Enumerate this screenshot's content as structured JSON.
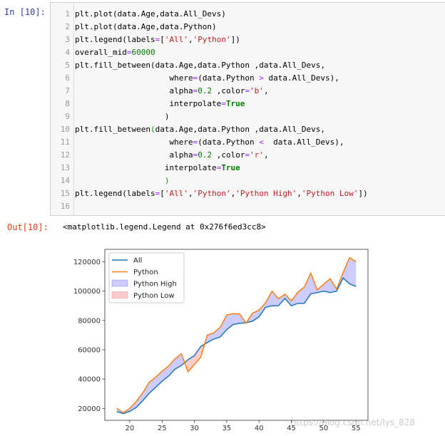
{
  "cell": {
    "in_prompt": "In [10]:",
    "out_prompt": "Out[10]:",
    "output_text": "<matplotlib.legend.Legend at 0x276f6ed3cc8>",
    "line_numbers": [
      "1",
      "2",
      "3",
      "4",
      "5",
      "6",
      "7",
      "8",
      "9",
      "10",
      "11",
      "12",
      "13",
      "14",
      "15",
      "16"
    ],
    "code_lines": [
      [
        [
          "plt.plot(data.Age,data.All_Devs)",
          ""
        ]
      ],
      [
        [
          "plt.plot(data.Age,data.Python)",
          ""
        ]
      ],
      [
        [
          "plt.legend(labels",
          ""
        ],
        [
          "=",
          "op"
        ],
        [
          "[",
          ""
        ],
        [
          "'All'",
          "str"
        ],
        [
          ",",
          ""
        ],
        [
          "'Python'",
          "str"
        ],
        [
          "])",
          ""
        ]
      ],
      [
        [
          "overall_mid",
          ""
        ],
        [
          "=",
          "op"
        ],
        [
          "60000",
          "num"
        ]
      ],
      [
        [
          "plt.fill_between(data.Age,data.Python ,data.All_Devs,",
          ""
        ]
      ],
      [
        [
          "                    where",
          ""
        ],
        [
          "=",
          "op"
        ],
        [
          "(data.Python ",
          ""
        ],
        [
          ">",
          "op"
        ],
        [
          " data.All_Devs),",
          ""
        ]
      ],
      [
        [
          "                    alpha",
          ""
        ],
        [
          "=",
          "op"
        ],
        [
          "0.2",
          "num"
        ],
        [
          " ,color",
          ""
        ],
        [
          "=",
          "op"
        ],
        [
          "'b'",
          "str"
        ],
        [
          ",",
          ""
        ]
      ],
      [
        [
          "                    interpolate",
          ""
        ],
        [
          "=",
          "op"
        ],
        [
          "True",
          "kw"
        ]
      ],
      [
        [
          "                   )",
          ""
        ]
      ],
      [
        [
          "plt.fill_between",
          ""
        ],
        [
          "(",
          "br"
        ],
        [
          "data.Age,data.Python ,data.All_Devs,",
          ""
        ]
      ],
      [
        [
          "                    where",
          ""
        ],
        [
          "=",
          "op"
        ],
        [
          "(data.Python ",
          ""
        ],
        [
          "<",
          "op"
        ],
        [
          "  data.All_Devs),",
          ""
        ]
      ],
      [
        [
          "                    alpha",
          ""
        ],
        [
          "=",
          "op"
        ],
        [
          "0.2",
          "num"
        ],
        [
          " ,color",
          ""
        ],
        [
          "=",
          "op"
        ],
        [
          "'r'",
          "str"
        ],
        [
          ",",
          ""
        ]
      ],
      [
        [
          "                   interpolate",
          ""
        ],
        [
          "=",
          "op"
        ],
        [
          "True",
          "kw"
        ]
      ],
      [
        [
          "                   ",
          ""
        ],
        [
          ")",
          "br"
        ]
      ],
      [
        [
          "plt.legend(labels",
          ""
        ],
        [
          "=",
          "op"
        ],
        [
          "[",
          ""
        ],
        [
          "'All'",
          "str"
        ],
        [
          ",",
          ""
        ],
        [
          "'Python'",
          "str"
        ],
        [
          ",",
          ""
        ],
        [
          "'Python High'",
          "str"
        ],
        [
          ",",
          ""
        ],
        [
          "'Python Low'",
          "str"
        ],
        [
          "])",
          ""
        ]
      ],
      [
        [
          "",
          ""
        ]
      ]
    ]
  },
  "watermark": "https://blog.csdn.net/lys_828",
  "chart_data": {
    "type": "line",
    "x": [
      18,
      19,
      20,
      21,
      22,
      23,
      24,
      25,
      26,
      27,
      28,
      29,
      30,
      31,
      32,
      33,
      34,
      35,
      36,
      37,
      38,
      39,
      40,
      41,
      42,
      43,
      44,
      45,
      46,
      47,
      48,
      49,
      50,
      51,
      52,
      53,
      54,
      55
    ],
    "series": [
      {
        "name": "All",
        "color": "#1f77b4",
        "values": [
          17784,
          16500,
          18012,
          20628,
          25206,
          30252,
          34368,
          38496,
          42000,
          46752,
          49320,
          53200,
          56000,
          62316,
          64928,
          67317,
          68748,
          73752,
          77232,
          78000,
          78508,
          79536,
          82488,
          88935,
          90000,
          90056,
          95000,
          90000,
          91633,
          91660,
          98150,
          98964,
          100000,
          98988,
          100000,
          108923,
          105000,
          103117
        ]
      },
      {
        "name": "Python",
        "color": "#ff7f0e",
        "values": [
          20046,
          17100,
          20000,
          24744,
          30500,
          37732,
          41247,
          45372,
          48876,
          53850,
          57287,
          45000,
          50000,
          55000,
          70000,
          71496,
          75370,
          83640,
          84666,
          84392,
          78254,
          85000,
          87038,
          91991,
          100000,
          94796,
          97962,
          93302,
          99240,
          102736,
          112285,
          100771,
          104708,
          108423,
          101407,
          112542,
          122870,
          120000
        ]
      }
    ],
    "fills": [
      {
        "name": "Python High",
        "color": "#0000ff",
        "alpha": 0.2,
        "where": "Python > All"
      },
      {
        "name": "Python Low",
        "color": "#ff0000",
        "alpha": 0.2,
        "where": "Python < All"
      }
    ],
    "xticks": [
      20,
      25,
      30,
      35,
      40,
      45,
      50,
      55
    ],
    "yticks": [
      20000,
      40000,
      60000,
      80000,
      100000,
      120000
    ],
    "xlim": [
      16.15,
      56.85
    ],
    "ylim": [
      11882,
      128488
    ],
    "legend": [
      "All",
      "Python",
      "Python High",
      "Python Low"
    ],
    "legend_placement": "upper-left",
    "grid": false
  }
}
